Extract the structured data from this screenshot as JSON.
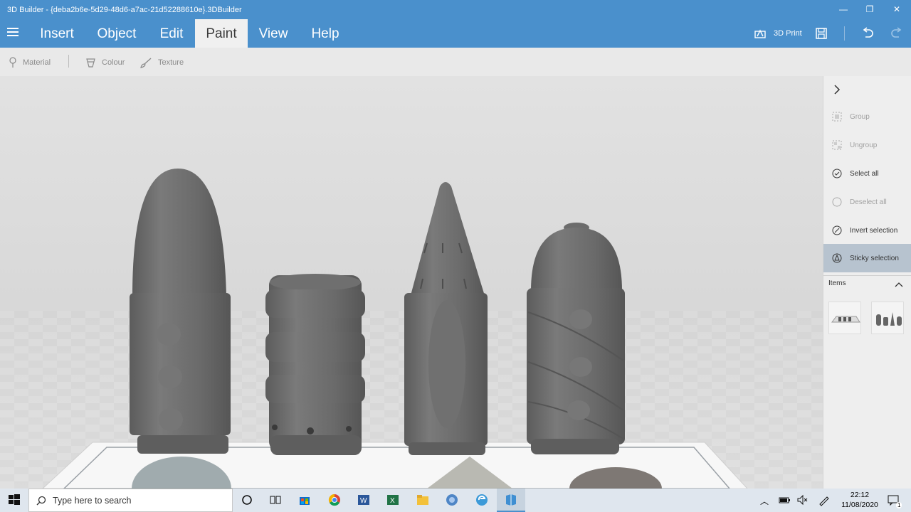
{
  "window": {
    "title": "3D Builder - {deba2b6e-5d29-48d6-a7ac-21d52288610e}.3DBuilder",
    "minimize_glyph": "—",
    "maximize_glyph": "❐",
    "close_glyph": "✕"
  },
  "menu": {
    "tabs": [
      {
        "label": "Insert"
      },
      {
        "label": "Object"
      },
      {
        "label": "Edit"
      },
      {
        "label": "Paint",
        "active": true
      },
      {
        "label": "View"
      },
      {
        "label": "Help"
      }
    ],
    "print_label": "3D Print"
  },
  "toolbar": {
    "material_label": "Material",
    "colour_label": "Colour",
    "texture_label": "Texture"
  },
  "sidepanel": {
    "group_label": "Group",
    "ungroup_label": "Ungroup",
    "select_all_label": "Select all",
    "deselect_all_label": "Deselect all",
    "invert_selection_label": "Invert selection",
    "sticky_selection_label": "Sticky selection",
    "items_label": "Items"
  },
  "taskbar": {
    "search_placeholder": "Type here to search",
    "time": "22:12",
    "date": "11/08/2020",
    "notification_count": "1"
  },
  "colors": {
    "accent": "#4a90cc",
    "model_grey": "#6b6b6b",
    "active_item": "#b7c3cf"
  }
}
